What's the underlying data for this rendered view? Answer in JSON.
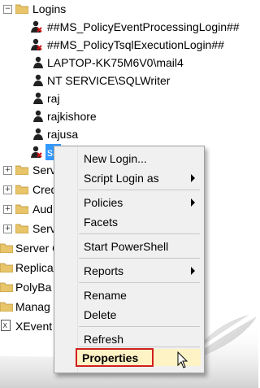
{
  "tree": {
    "logins_label": "Logins",
    "items": [
      {
        "label": "##MS_PolicyEventProcessingLogin##",
        "icon": "disabled-login-icon"
      },
      {
        "label": "##MS_PolicyTsqlExecutionLogin##",
        "icon": "disabled-login-icon"
      },
      {
        "label": "LAPTOP-KK75M6V0\\mail4",
        "icon": "login-icon"
      },
      {
        "label": "NT SERVICE\\SQLWriter",
        "icon": "login-icon"
      },
      {
        "label": "raj",
        "icon": "login-icon"
      },
      {
        "label": "rajkishore",
        "icon": "login-icon"
      },
      {
        "label": "rajusa",
        "icon": "login-icon"
      },
      {
        "label": "sa",
        "icon": "disabled-login-icon",
        "selected": true
      }
    ],
    "folders": [
      {
        "label": "Serv"
      },
      {
        "label": "Cred"
      },
      {
        "label": "Aud"
      },
      {
        "label": "Serv"
      }
    ],
    "root_folders": [
      {
        "label": "Server O"
      },
      {
        "label": "Replica"
      },
      {
        "label": "PolyBa"
      },
      {
        "label": "Manag"
      },
      {
        "label": "XEvent"
      }
    ]
  },
  "context_menu": {
    "items": [
      {
        "label": "New Login...",
        "submenu": false
      },
      {
        "label": "Script Login as",
        "submenu": true
      },
      {
        "label": "Policies",
        "submenu": true
      },
      {
        "label": "Facets",
        "submenu": false
      },
      {
        "label": "Start PowerShell",
        "submenu": false
      },
      {
        "label": "Reports",
        "submenu": true
      },
      {
        "label": "Rename",
        "submenu": false
      },
      {
        "label": "Delete",
        "submenu": false
      },
      {
        "label": "Refresh",
        "submenu": false
      },
      {
        "label": "Properties",
        "submenu": false,
        "highlighted": true
      }
    ]
  },
  "colors": {
    "selection": "#3399ff",
    "highlight_box": "#d11f1f",
    "folder": "#e8c46a",
    "menu_bg": "#f0f0f0"
  }
}
